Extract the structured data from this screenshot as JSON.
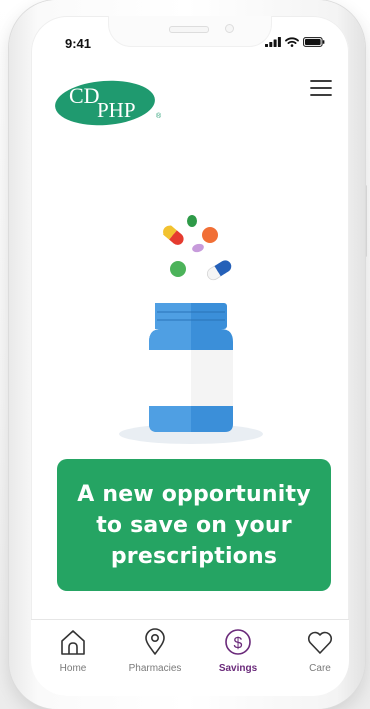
{
  "status_bar": {
    "time": "9:41",
    "icons": [
      "signal-icon",
      "wifi-icon",
      "battery-icon"
    ]
  },
  "header": {
    "logo_text_top": "CD",
    "logo_text_bottom": "PHP",
    "logo_mark": "®",
    "menu_icon": "hamburger-menu-icon"
  },
  "hero": {
    "illustration": "pill-bottle-with-pills-illustration"
  },
  "promo": {
    "text": "A new opportunity\nto save on your\nprescriptions"
  },
  "tab_bar": {
    "items": [
      {
        "label": "Home",
        "icon": "home-icon",
        "active": false
      },
      {
        "label": "Pharmacies",
        "icon": "location-pin-icon",
        "active": false
      },
      {
        "label": "Savings",
        "icon": "dollar-circle-icon",
        "active": true
      },
      {
        "label": "Care",
        "icon": "heart-icon",
        "active": false
      }
    ]
  },
  "colors": {
    "brand_green": "#25a463",
    "logo_green": "#1f9a6f",
    "active_purple": "#6a2a7a",
    "inactive_gray": "#7a7a7a",
    "bottle_blue": "#3b8fd9"
  }
}
